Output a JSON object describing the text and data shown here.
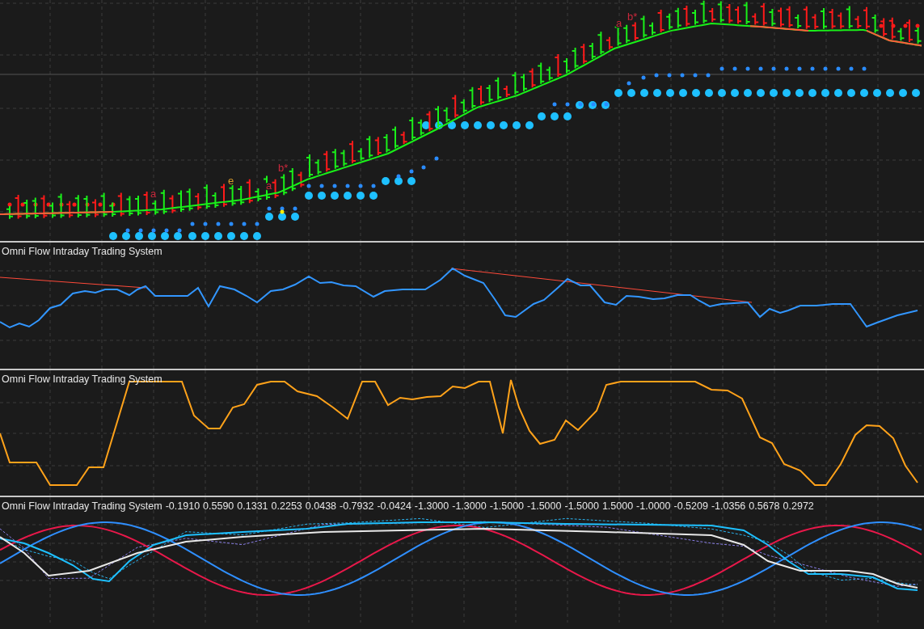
{
  "price_panel": {
    "signal_labels": [
      {
        "text": "a",
        "color": "#c8283c"
      },
      {
        "text": "e",
        "color": "#d89a2a"
      },
      {
        "text": "a",
        "color": "#c8283c"
      },
      {
        "text": "b*",
        "color": "#c8283c"
      },
      {
        "text": "a",
        "color": "#c8283c"
      },
      {
        "text": "b*",
        "color": "#c8283c"
      }
    ]
  },
  "indicator_panels": [
    {
      "kind": "line",
      "title": "Omni Flow Intraday Trading System"
    },
    {
      "kind": "line",
      "title": "Omni Flow Intraday Trading System"
    },
    {
      "kind": "waves",
      "title": "Omni Flow Intraday Trading System",
      "values": [
        "-0.1910",
        "0.5590",
        "0.1331",
        "0.2253",
        "0.0438",
        "-0.7932",
        "-0.0424",
        "-1.3000",
        "-1.3000",
        "-1.5000",
        "-1.5000",
        "-1.5000",
        "1.5000",
        "-1.0000",
        "-0.5209",
        "-1.0356",
        "0.5678",
        "0.2972"
      ]
    }
  ]
}
